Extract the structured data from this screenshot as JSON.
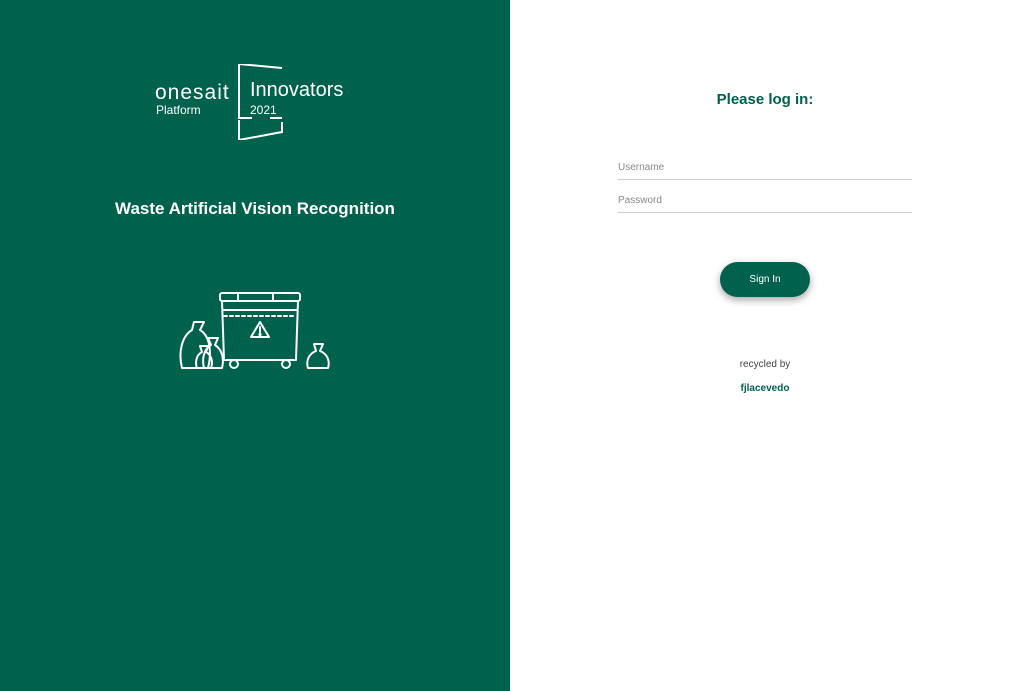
{
  "branding": {
    "brand_name": "onesait",
    "platform_label": "Platform",
    "event_name": "Innovators",
    "event_year": "2021",
    "app_title": "Waste Artificial Vision Recognition"
  },
  "login": {
    "heading": "Please log in:",
    "username_placeholder": "Username",
    "password_placeholder": "Password",
    "signin_label": "Sign In"
  },
  "credits": {
    "recycled_by_label": "recycled by",
    "author": "fjlacevedo"
  },
  "colors": {
    "primary": "#00614d",
    "background": "#ffffff"
  },
  "icons": {
    "logo": "onesait-innovators-logo",
    "illustration": "waste-container-with-bags-icon"
  }
}
